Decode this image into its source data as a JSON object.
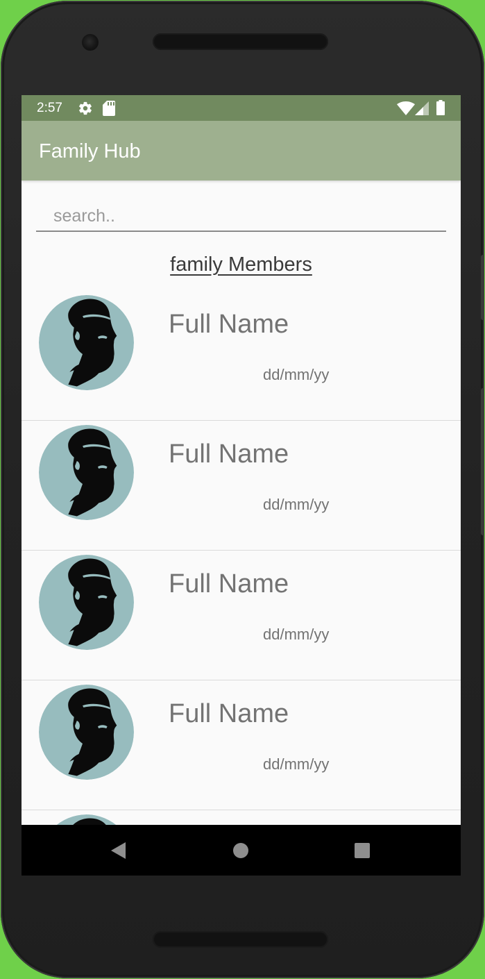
{
  "status_bar": {
    "time": "2:57",
    "icons": [
      "settings-icon",
      "sd-card-icon",
      "wifi-icon",
      "cell-signal-icon",
      "battery-icon"
    ]
  },
  "app_bar": {
    "title": "Family Hub",
    "color": "#9eb08f",
    "status_color": "#718a5f"
  },
  "search": {
    "placeholder": "search.."
  },
  "section": {
    "title": "family Members"
  },
  "members": [
    {
      "name": "Full Name",
      "date": "dd/mm/yy",
      "avatar": "bearded-man-avatar-icon"
    },
    {
      "name": "Full Name",
      "date": "dd/mm/yy",
      "avatar": "bearded-man-avatar-icon"
    },
    {
      "name": "Full Name",
      "date": "dd/mm/yy",
      "avatar": "bearded-man-avatar-icon"
    },
    {
      "name": "Full Name",
      "date": "dd/mm/yy",
      "avatar": "bearded-man-avatar-icon"
    },
    {
      "name": "",
      "date": "",
      "avatar": "bearded-man-avatar-icon"
    }
  ],
  "nav_bar": {
    "buttons": [
      "back-icon",
      "home-icon",
      "recents-icon"
    ]
  },
  "colors": {
    "background": "#6fd04a",
    "avatar_bg": "#97bcbe"
  }
}
